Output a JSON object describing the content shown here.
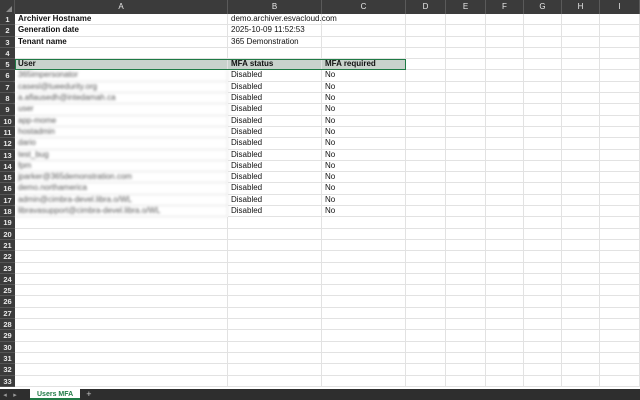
{
  "columns": [
    "A",
    "B",
    "C",
    "D",
    "E",
    "F",
    "G",
    "H",
    "I"
  ],
  "info_rows": [
    {
      "label": "Archiver Hostname",
      "value": "demo.archiver.esvacloud.com"
    },
    {
      "label": "Generation date",
      "value": "2025-10-09 11:52:53"
    },
    {
      "label": "Tenant name",
      "value": "365 Demonstration"
    }
  ],
  "table_header": {
    "user": "User",
    "mfa_status": "MFA status",
    "mfa_required": "MFA required"
  },
  "users": [
    {
      "user": "365impersonator",
      "mfa_status": "Disabled",
      "mfa_required": "No"
    },
    {
      "user": "casesl@tueedurity.org",
      "mfa_status": "Disabled",
      "mfa_required": "No"
    },
    {
      "user": "a.aflausedh@intedamah.ca",
      "mfa_status": "Disabled",
      "mfa_required": "No"
    },
    {
      "user": "user",
      "mfa_status": "Disabled",
      "mfa_required": "No"
    },
    {
      "user": "app-mome",
      "mfa_status": "Disabled",
      "mfa_required": "No"
    },
    {
      "user": "hostadmin",
      "mfa_status": "Disabled",
      "mfa_required": "No"
    },
    {
      "user": "dario",
      "mfa_status": "Disabled",
      "mfa_required": "No"
    },
    {
      "user": "test_bug",
      "mfa_status": "Disabled",
      "mfa_required": "No"
    },
    {
      "user": "fpm",
      "mfa_status": "Disabled",
      "mfa_required": "No"
    },
    {
      "user": "jparker@365demonstration.com",
      "mfa_status": "Disabled",
      "mfa_required": "No"
    },
    {
      "user": "demo.northamerica",
      "mfa_status": "Disabled",
      "mfa_required": "No"
    },
    {
      "user": "admin@cimbra-devel.libra.o/WL",
      "mfa_status": "Disabled",
      "mfa_required": "No"
    },
    {
      "user": "libravasupport@cimbra-devel.libra.o/WL",
      "mfa_status": "Disabled",
      "mfa_required": "No"
    }
  ],
  "total_rows": 33,
  "sheet_tab": "Users MFA",
  "add_tab": "+",
  "nav_prev": "◂",
  "nav_next": "▸",
  "colors": {
    "accent": "#1f7a45",
    "header_fill": "#c9d2cc",
    "chrome": "#3b3b3b"
  }
}
